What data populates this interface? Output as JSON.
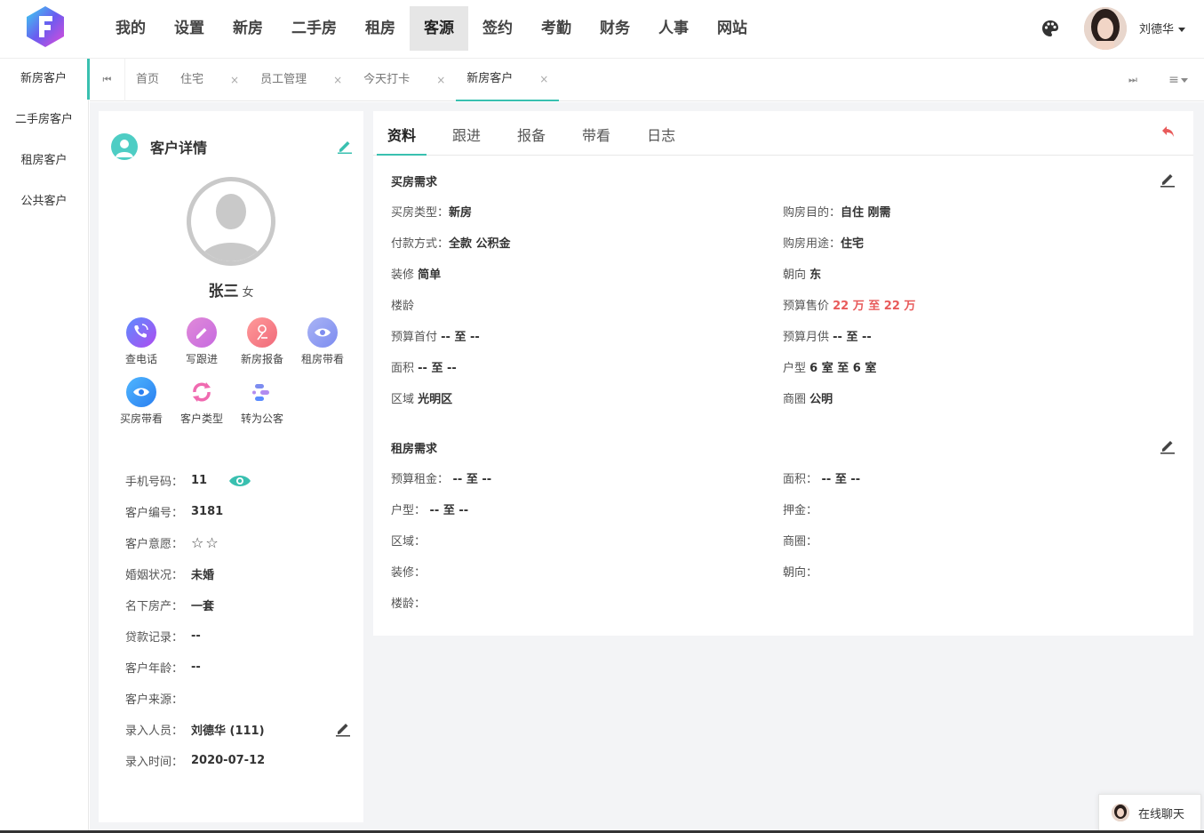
{
  "nav": {
    "items": [
      "我的",
      "设置",
      "新房",
      "二手房",
      "租房",
      "客源",
      "签约",
      "考勤",
      "财务",
      "人事",
      "网站"
    ],
    "active_index": 5
  },
  "user": {
    "name": "刘德华"
  },
  "sidebar": {
    "items": [
      "新房客户",
      "二手房客户",
      "租房客户",
      "公共客户"
    ],
    "active_index": 0
  },
  "tabs": {
    "items": [
      {
        "label": "首页",
        "closable": false
      },
      {
        "label": "住宅",
        "closable": true
      },
      {
        "label": "员工管理",
        "closable": true
      },
      {
        "label": "今天打卡",
        "closable": true
      },
      {
        "label": "新房客户",
        "closable": true
      }
    ],
    "active_index": 4,
    "close_glyph": "×"
  },
  "customer": {
    "title": "客户详情",
    "name": "张三",
    "gender": "女",
    "actions": [
      "查电话",
      "写跟进",
      "新房报备",
      "租房带看",
      "买房带看",
      "客户类型",
      "转为公客"
    ],
    "info": [
      {
        "k": "手机号码：",
        "v": "11"
      },
      {
        "k": "客户编号：",
        "v": "3181"
      },
      {
        "k": "客户意愿：",
        "v": "",
        "stars": 2
      },
      {
        "k": "婚姻状况：",
        "v": "未婚"
      },
      {
        "k": "名下房产：",
        "v": "一套"
      },
      {
        "k": "贷款记录：",
        "v": "--"
      },
      {
        "k": "客户年龄：",
        "v": "--"
      },
      {
        "k": "客户来源：",
        "v": ""
      },
      {
        "k": "录入人员：",
        "v": "刘德华 (111)"
      },
      {
        "k": "录入时间：",
        "v": "2020-07-12"
      }
    ]
  },
  "detail": {
    "tabs": [
      "资料",
      "跟进",
      "报备",
      "带看",
      "日志"
    ],
    "active_index": 0,
    "buy": {
      "title": "买房需求",
      "fields": [
        {
          "k": "买房类型：",
          "v": "新房"
        },
        {
          "k": "购房目的：",
          "v": "自住 刚需"
        },
        {
          "k": "付款方式：",
          "v": "全款 公积金"
        },
        {
          "k": "购房用途：",
          "v": "住宅"
        },
        {
          "k": "装修 ",
          "v": "简单"
        },
        {
          "k": "朝向 ",
          "v": "东"
        },
        {
          "k": "楼龄",
          "v": ""
        },
        {
          "k": "预算售价 ",
          "v": "22 万 至 22 万",
          "red": true
        },
        {
          "k": "预算首付 ",
          "v": "-- 至 --"
        },
        {
          "k": "预算月供 ",
          "v": "-- 至 --"
        },
        {
          "k": "面积 ",
          "v": "-- 至 --"
        },
        {
          "k": "户型 ",
          "v": "6 室 至 6 室"
        },
        {
          "k": "区域 ",
          "v": "光明区"
        },
        {
          "k": "商圈 ",
          "v": "公明"
        }
      ]
    },
    "rent": {
      "title": "租房需求",
      "fields": [
        {
          "k": "预算租金：",
          "v": " -- 至 --"
        },
        {
          "k": "面积：",
          "v": " -- 至 --"
        },
        {
          "k": "户型：",
          "v": " -- 至 --"
        },
        {
          "k": "押金：",
          "v": ""
        },
        {
          "k": "区域：",
          "v": ""
        },
        {
          "k": "商圈：",
          "v": ""
        },
        {
          "k": "装修：",
          "v": ""
        },
        {
          "k": "朝向：",
          "v": ""
        },
        {
          "k": "楼龄：",
          "v": ""
        }
      ]
    }
  },
  "chat": {
    "label": "在线聊天"
  },
  "colors": {
    "accent": "#39c0b0",
    "red": "#e85a5a"
  }
}
